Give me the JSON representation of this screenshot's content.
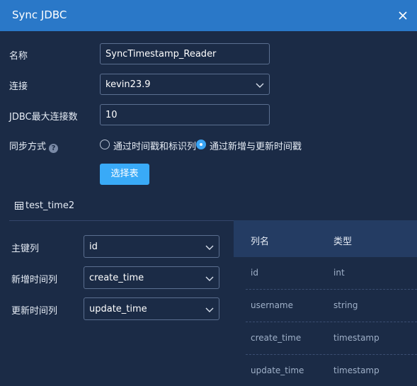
{
  "dialog": {
    "title": "Sync JDBC"
  },
  "form": {
    "name_label": "名称",
    "name_value": "SyncTimestamp_Reader",
    "connection_label": "连接",
    "connection_value": "kevin23.9",
    "max_conn_label": "JDBC最大连接数",
    "max_conn_value": "10",
    "sync_mode_label": "同步方式",
    "sync_mode_options": [
      {
        "label": "通过时间戳和标识列",
        "selected": false
      },
      {
        "label": "通过新增与更新时间戳",
        "selected": true
      }
    ],
    "select_table_button": "选择表"
  },
  "table": {
    "name": "test_time2",
    "primary_key_label": "主键列",
    "primary_key_value": "id",
    "create_time_label": "新增时间列",
    "create_time_value": "create_time",
    "update_time_label": "更新时间列",
    "update_time_value": "update_time"
  },
  "columns": {
    "headers": [
      "列名",
      "类型"
    ],
    "rows": [
      {
        "name": "id",
        "type": "int"
      },
      {
        "name": "username",
        "type": "string"
      },
      {
        "name": "create_time",
        "type": "timestamp"
      },
      {
        "name": "update_time",
        "type": "timestamp"
      }
    ]
  },
  "colors": {
    "titlebar": "#2a78c8",
    "background": "#1b2b46",
    "accent": "#39aaf7",
    "header_row": "#243c63"
  },
  "icons": {
    "close": "close-icon",
    "chevron": "chevron-down-icon",
    "help": "help-icon",
    "table": "table-icon"
  }
}
